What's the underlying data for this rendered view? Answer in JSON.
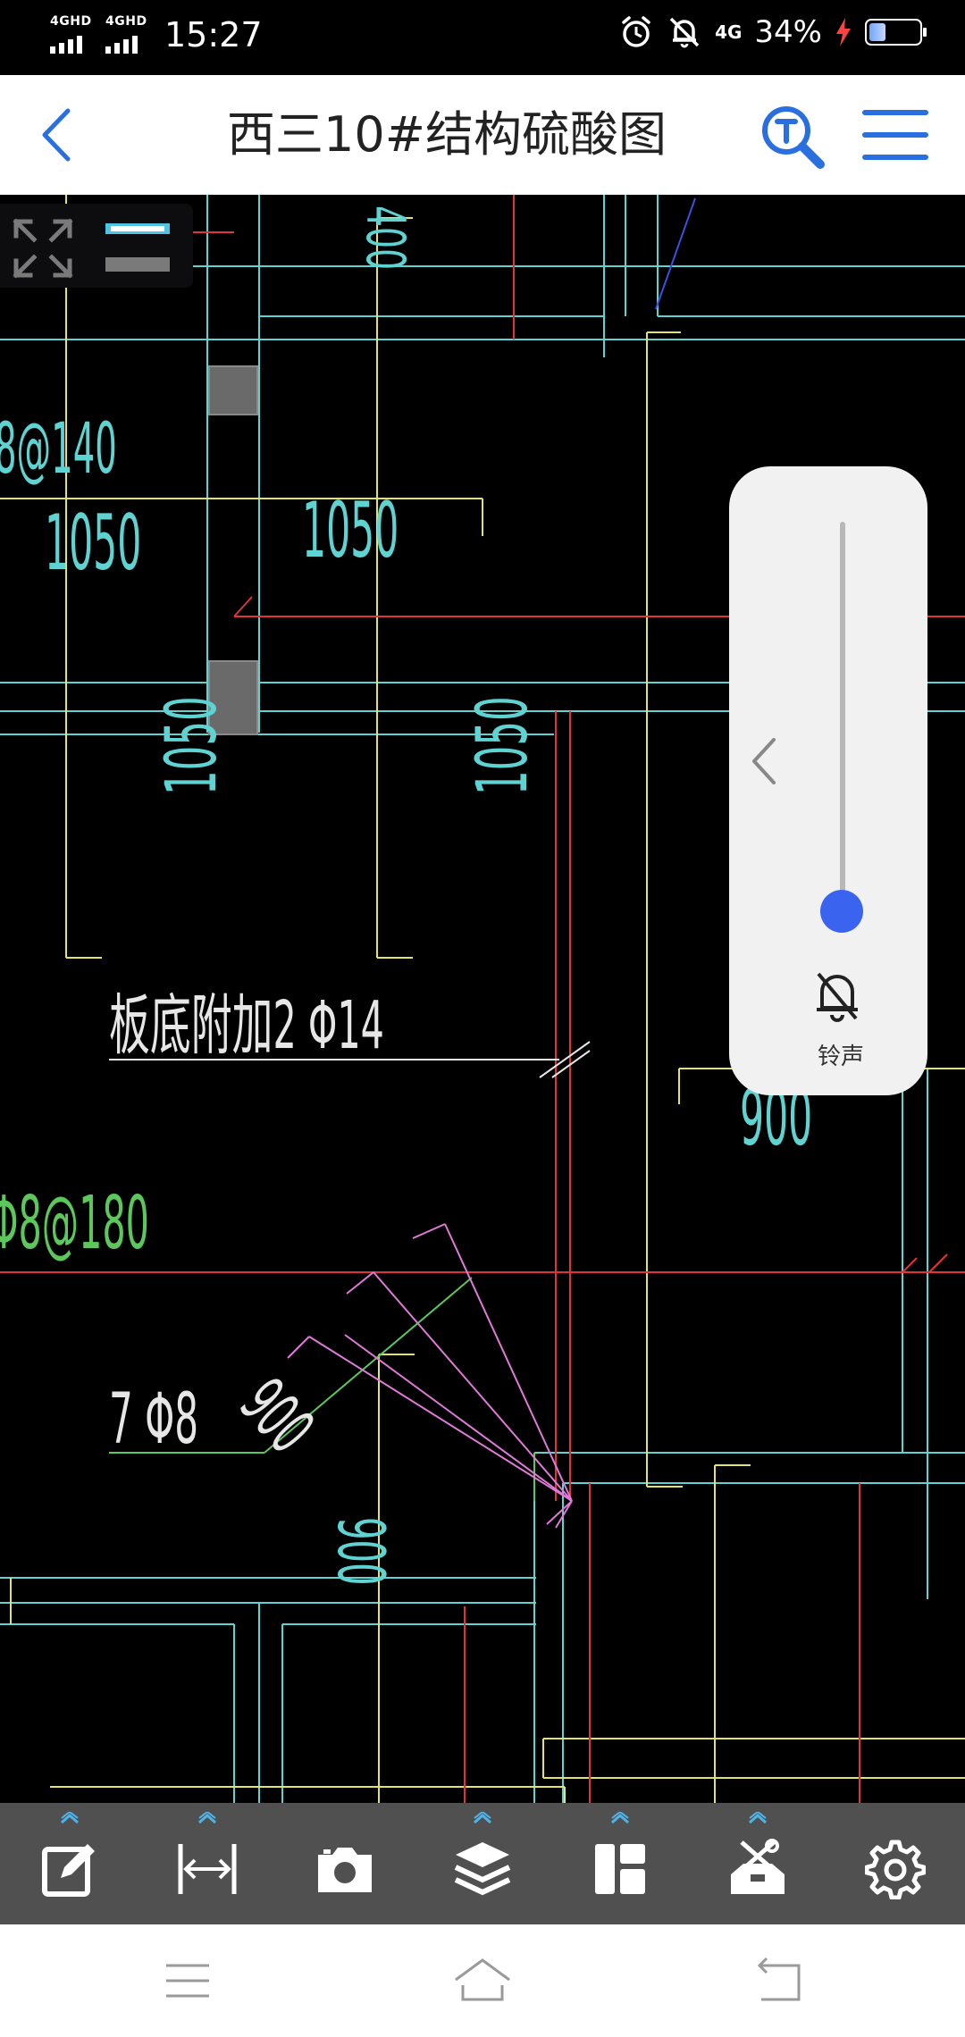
{
  "status_bar": {
    "sim1_network": "4GHD",
    "sim2_network": "4GHD",
    "time": "15:27",
    "data_network": "4G",
    "battery_percent": "34%",
    "battery_level": 0.34,
    "icons": [
      "alarm-icon",
      "mute-icon",
      "charging-icon"
    ]
  },
  "header": {
    "title": "西三10#结构硫酸图",
    "back_icon": "chevron-left-icon",
    "text_search_icon": "text-search-icon",
    "menu_icon": "hamburger-menu-icon"
  },
  "drawing": {
    "labels": {
      "rebar_top_left": "8@140",
      "dim_1050_a": "1050",
      "dim_1050_b": "1050",
      "dim_1050_c": "1050",
      "dim_1050_d": "1050",
      "dim_400": "400",
      "note_slab": "板底附加2 Φ14",
      "rebar_180": "Φ8@180",
      "rebar_7": "7 Φ8",
      "dim_900_a": "900",
      "dim_900_b": "900",
      "dim_900_c": "900"
    }
  },
  "volume_popup": {
    "label": "铃声",
    "level": 0.0
  },
  "toolbar": {
    "items": [
      "edit-annotation-icon",
      "measure-icon",
      "camera-icon",
      "layers-icon",
      "layout-icon",
      "toolbox-icon",
      "settings-icon"
    ]
  },
  "colors": {
    "cad_background": "#000000",
    "cyan": "#5fd2d2",
    "yellow": "#e3e36a",
    "red": "#e0343a",
    "green": "#5cc85c",
    "white": "#e6e6e6",
    "magenta": "#e07ad8",
    "accent_blue": "#2a6fe0",
    "toolbar_bg": "#505050"
  }
}
